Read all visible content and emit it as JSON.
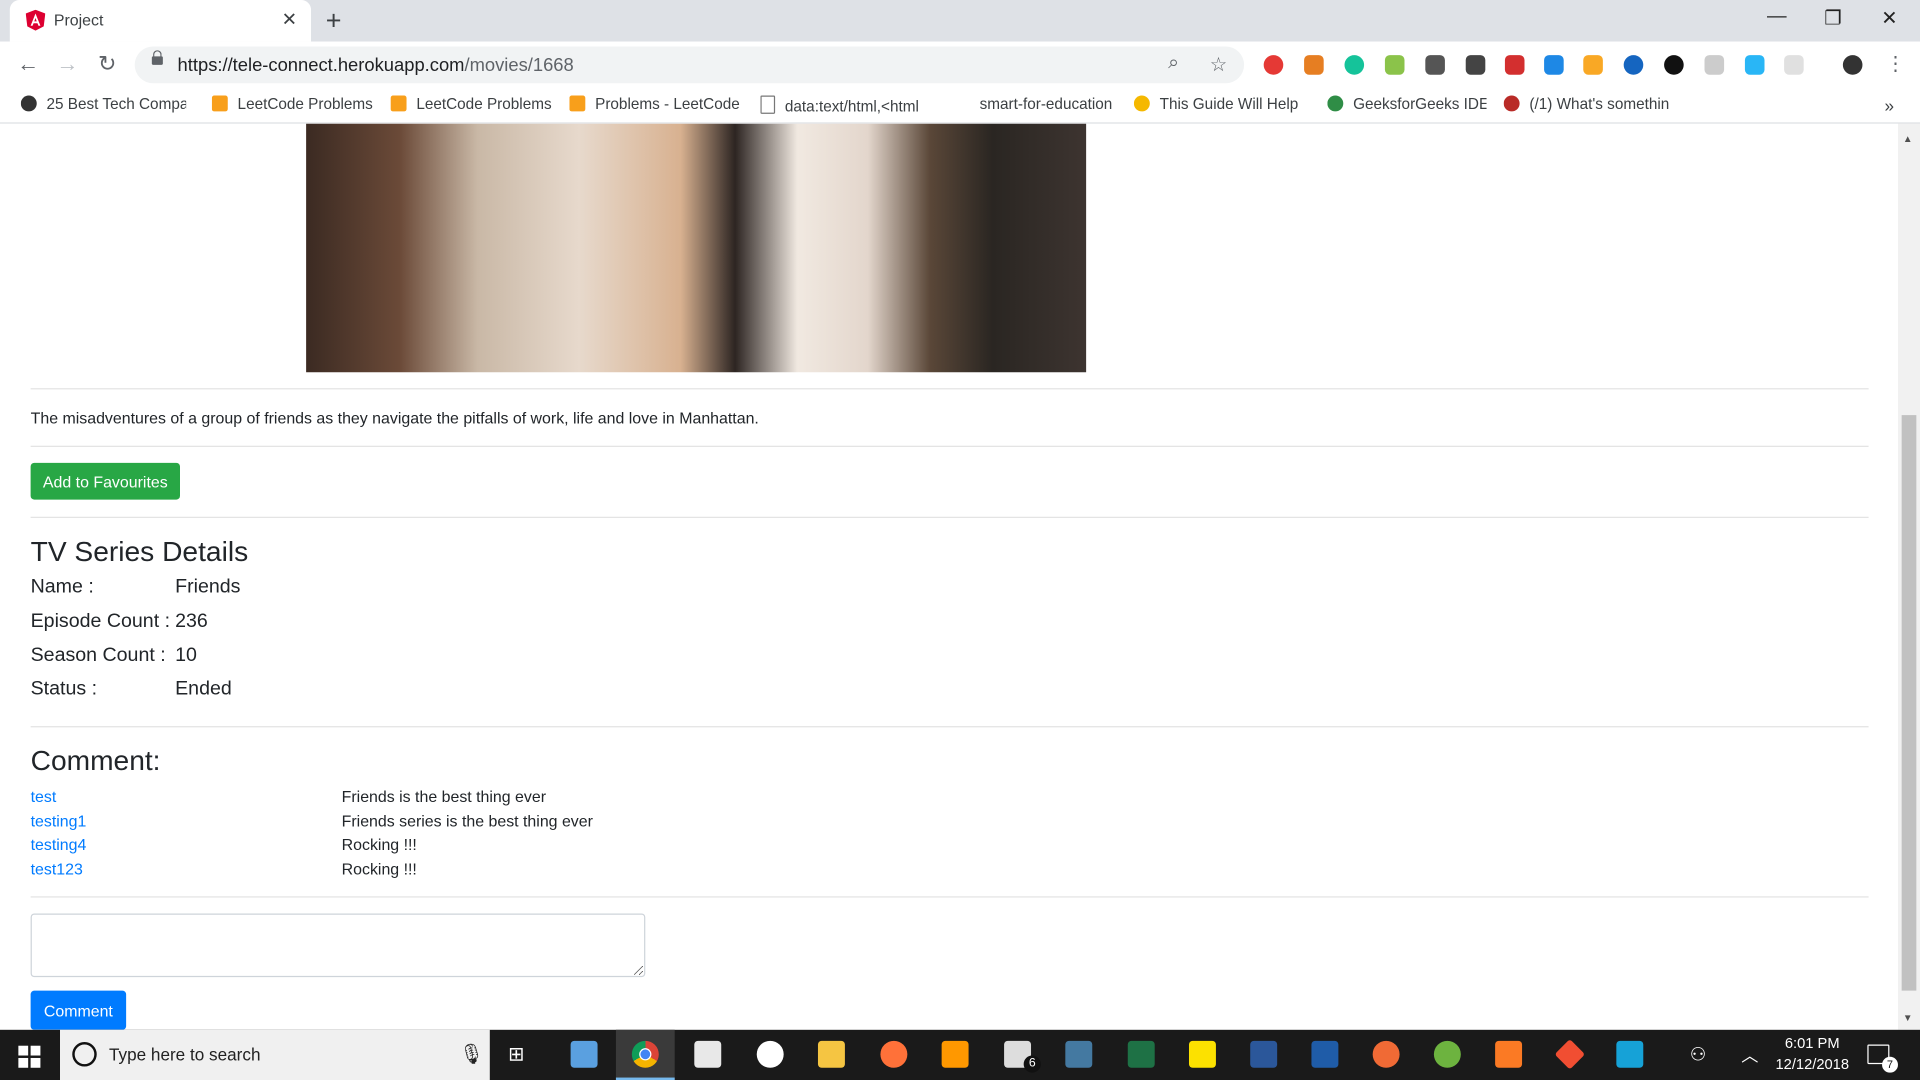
{
  "browser": {
    "tab_title": "Project",
    "new_tab_symbol": "+",
    "url_domain": "https://tele-connect.herokuapp.com",
    "url_path": "/movies/1668",
    "bookmarks": [
      "25 Best Tech Compar",
      "LeetCode Problems",
      "LeetCode Problems",
      "Problems - LeetCode",
      "data:text/html,<html",
      "smart-for-education",
      "This Guide Will Help",
      "GeeksforGeeks IDE",
      "(/1) What's somethin"
    ],
    "overflow_symbol": "»"
  },
  "page": {
    "description": "The misadventures of a group of friends as they navigate the pitfalls of work, life and love in Manhattan.",
    "favourite_button": "Add to Favourites",
    "details_heading": "TV Series Details",
    "details": [
      {
        "label": "Name :",
        "value": "Friends"
      },
      {
        "label": "Episode Count :",
        "value": "236"
      },
      {
        "label": "Season Count :",
        "value": "10"
      },
      {
        "label": "Status :",
        "value": "Ended"
      }
    ],
    "comment_heading": "Comment:",
    "comments": [
      {
        "user": "test",
        "text": "Friends is the best thing ever"
      },
      {
        "user": "testing1",
        "text": "Friends series is the best thing ever"
      },
      {
        "user": "testing4",
        "text": "Rocking !!!"
      },
      {
        "user": "test123",
        "text": "Rocking !!!"
      }
    ],
    "comment_input_value": "",
    "comment_button": "Comment"
  },
  "taskbar": {
    "search_placeholder": "Type here to search",
    "mail_badge": "6",
    "time": "6:01 PM",
    "date": "12/12/2018",
    "notification_count": "7"
  },
  "colors": {
    "success": "#28a745",
    "primary": "#007bff",
    "link": "#007bff"
  }
}
